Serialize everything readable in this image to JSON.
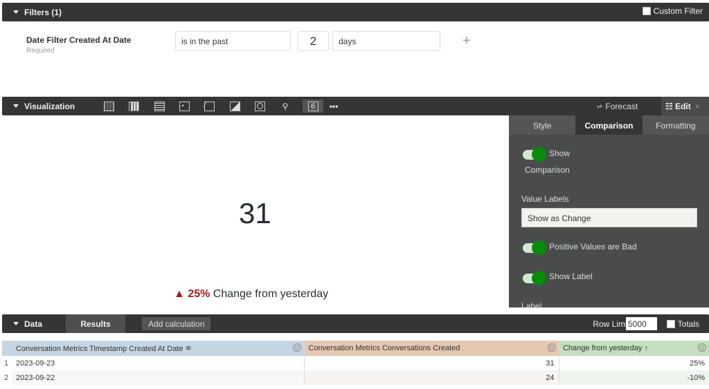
{
  "filters": {
    "title": "Filters (1)",
    "custom_filter_label": "Custom Filter",
    "field_label": "Date Filter Created At Date",
    "required_label": "Required",
    "operator": "is in the past",
    "number": "2",
    "unit": "days",
    "add_icon": "+"
  },
  "visualization": {
    "title": "Visualization",
    "types": [
      "table-icon",
      "bar-chart-icon",
      "horizontal-bar-icon",
      "scatter-icon",
      "line-chart-icon",
      "area-chart-icon",
      "pie-chart-icon",
      "map-pin-icon",
      "single-value-icon",
      "more-icon"
    ],
    "single_value_glyph": "6",
    "more_glyph": "•••",
    "forecast_label": "Forecast",
    "edit_label": "Edit",
    "close_glyph": "×",
    "value": "31",
    "comparison": {
      "arrow": "▲",
      "value": "25%",
      "label": "Change from yesterday"
    },
    "colors": {
      "comparison_bad": "#a11b1b",
      "toggle_on": "#0a8a0a"
    }
  },
  "edit_panel": {
    "tabs": [
      "Style",
      "Comparison",
      "Formatting"
    ],
    "active_tab": "Comparison",
    "show_comparison_label_1": "Show",
    "show_comparison_label_2": "Comparison",
    "value_labels_label": "Value Labels",
    "value_labels_selected": "Show as Change",
    "positive_bad_label": "Positive Values are Bad",
    "show_label_label": "Show Label",
    "label_label": "Label"
  },
  "data": {
    "title": "Data",
    "results_tab": "Results",
    "add_calc": "Add calculation",
    "row_limit_label": "Row Limit",
    "row_limit_value": "5000",
    "totals_label": "Totals",
    "columns": [
      "Conversation Metrics Timestamp Created At Date ≘",
      "Conversation Metrics Conversations Created",
      "Change from yesterday ↑"
    ],
    "rows": [
      {
        "n": "1",
        "date": "2023-09-23",
        "count": "31",
        "change": "25%"
      },
      {
        "n": "2",
        "date": "2023-09-22",
        "count": "24",
        "change": "-10%"
      }
    ]
  }
}
